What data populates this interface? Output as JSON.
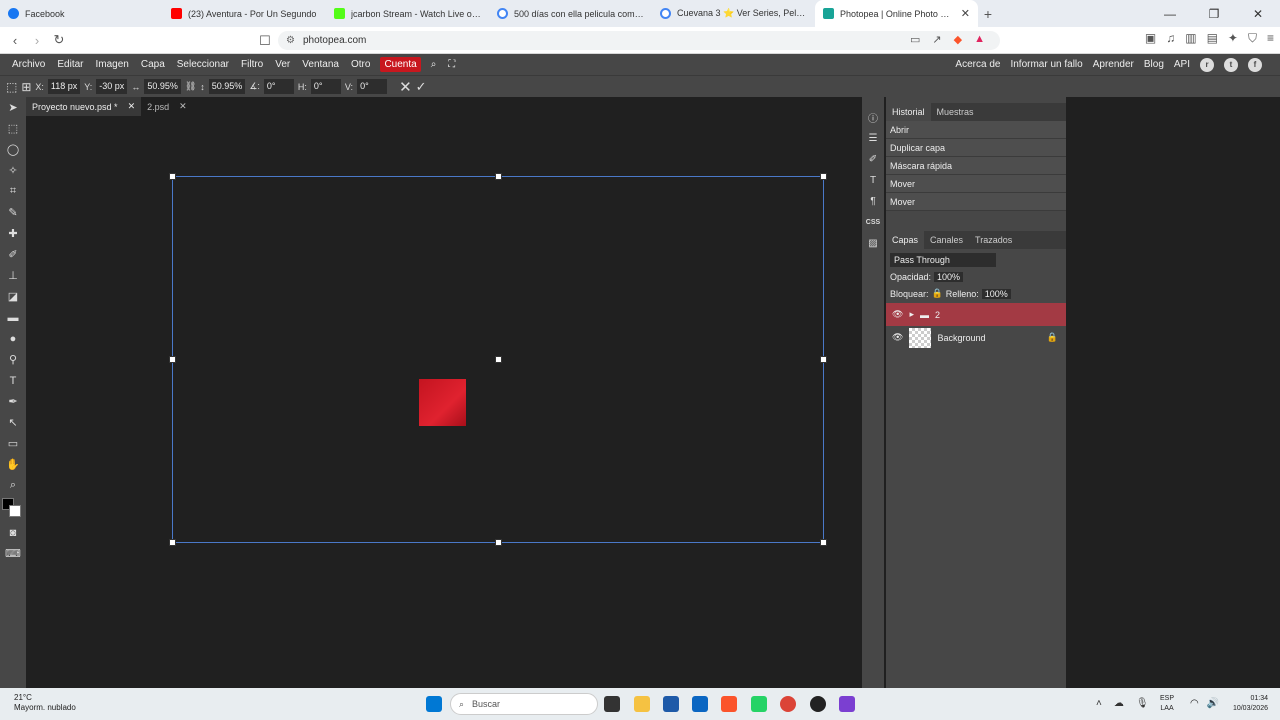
{
  "browser": {
    "tabs": [
      {
        "title": "Facebook",
        "color": "#1877f2"
      },
      {
        "title": "(23) Aventura - Por Un Segundo",
        "color": "#ff0000"
      },
      {
        "title": "jcarbon Stream - Watch Live on Kick",
        "color": "#53fc18"
      },
      {
        "title": "500 días con ella pelicula completa",
        "color": "#4285f4"
      },
      {
        "title": "Cuevana 3 ⭐ Ver Series, Películas y",
        "color": "#4285f4"
      },
      {
        "title": "Photopea | Online Photo Editor",
        "color": "#18a497"
      }
    ],
    "url": "photopea.com"
  },
  "menu": {
    "items": [
      "Archivo",
      "Editar",
      "Imagen",
      "Capa",
      "Seleccionar",
      "Filtro",
      "Ver",
      "Ventana",
      "Otro"
    ],
    "account": "Cuenta",
    "right": [
      "Acerca de",
      "Informar un fallo",
      "Aprender",
      "Blog",
      "API"
    ]
  },
  "options": {
    "x_label": "X:",
    "x": "118 px",
    "y_label": "Y:",
    "y": "-30 px",
    "w": "50.95%",
    "h": "50.95%",
    "angle_label": "∡:",
    "angle": "0°",
    "hskew_label": "H:",
    "hskew": "0°",
    "vskew_label": "V:",
    "vskew": "0°"
  },
  "doc_tabs": [
    "Proyecto nuevo.psd *",
    "2.psd"
  ],
  "history": {
    "tabs": [
      "Historial",
      "Muestras"
    ],
    "items": [
      "Abrir",
      "Duplicar capa",
      "Máscara rápida",
      "Mover",
      "Mover"
    ]
  },
  "layers": {
    "tabs": [
      "Capas",
      "Canales",
      "Trazados"
    ],
    "blend_mode": "Pass Through",
    "opacity_label": "Opacidad:",
    "opacity": "100%",
    "lock_label": "Bloquear:",
    "fill_label": "Relleno:",
    "fill": "100%",
    "items": [
      {
        "name": "2",
        "type": "group",
        "selected": true
      },
      {
        "name": "Background",
        "type": "layer",
        "locked": true
      }
    ]
  },
  "taskbar": {
    "weather_temp": "21°C",
    "weather_desc": "Mayorm. nublado",
    "search": "Buscar",
    "lang": "ESP",
    "lang2": "LAA",
    "time": "01:34",
    "date": "10/03/2026"
  },
  "colors": {
    "accent": "#c8171e",
    "selected_layer": "#a33a44",
    "selection": "#4a78c8"
  }
}
